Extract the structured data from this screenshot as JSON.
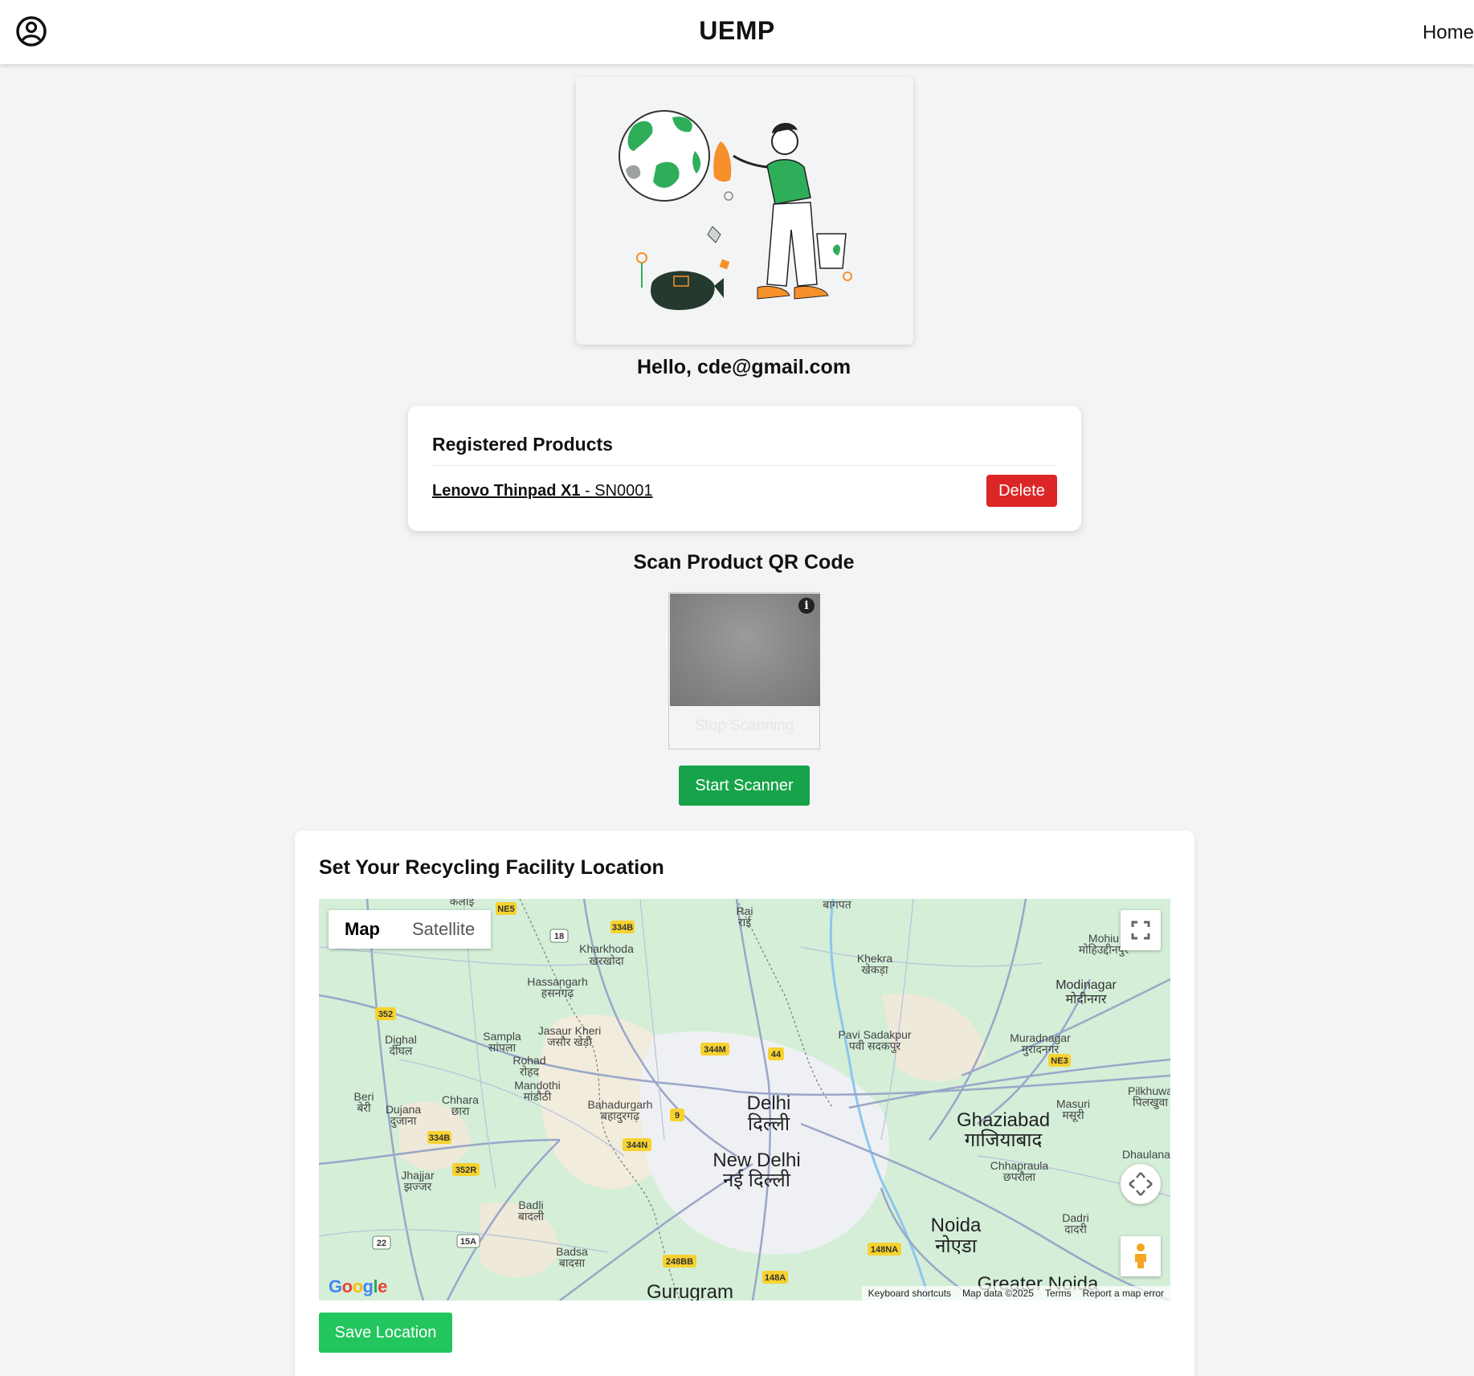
{
  "header": {
    "brand": "UEMP",
    "nav_home": "Home"
  },
  "greeting": "Hello, cde@gmail.com",
  "products": {
    "title": "Registered Products",
    "items": [
      {
        "name": "Lenovo Thinpad X1",
        "separator": " - ",
        "serial": "SN0001",
        "delete_label": "Delete"
      }
    ]
  },
  "scanner": {
    "title": "Scan Product QR Code",
    "stop_label": "Stop Scanning",
    "start_label": "Start Scanner"
  },
  "location": {
    "title": "Set Your Recycling Facility Location",
    "save_label": "Save Location",
    "map": {
      "type_map": "Map",
      "type_satellite": "Satellite",
      "active_type": "Map",
      "google": "Google",
      "footer": {
        "shortcuts": "Keyboard shortcuts",
        "data": "Map data ©2025",
        "terms": "Terms",
        "report": "Report a map error"
      },
      "places": {
        "delhi": "Delhi",
        "delhi_hi": "दिल्ली",
        "new_delhi": "New Delhi",
        "new_delhi_hi": "नई दिल्ली",
        "ghaziabad": "Ghaziabad",
        "ghaziabad_hi": "गाजियाबाद",
        "noida": "Noida",
        "noida_hi": "नोएडा",
        "greater_noida": "Greater Noida",
        "gurugram": "Gurugram",
        "modinagar": "Modinagar",
        "modinagar_hi": "मोदीनगर",
        "kharkhoda": "Kharkhoda",
        "kharkhoda_hi": "खरखोदा",
        "hassangarh": "Hassangarh",
        "hassangarh_hi": "हसनगढ़",
        "khekra": "Khekra",
        "khekra_hi": "खेकड़ा",
        "pavi": "Pavi Sadakpur",
        "pavi_hi": "पवी सदकपुर",
        "muradnagar": "Muradnagar",
        "muradnagar_hi": "मुरादनगर",
        "sampla": "Sampla",
        "sampla_hi": "सांपला",
        "jasaur": "Jasaur Kheri",
        "jasaur_hi": "जसौर खेड़ी",
        "rohad": "Rohad",
        "rohad_hi": "रोहद",
        "dighal": "Dighal",
        "dighal_hi": "दीघल",
        "mandothi": "Mandothi",
        "mandothi_hi": "मांडौठी",
        "chhara": "Chhara",
        "chhara_hi": "छारा",
        "bahadurgarh": "Bahadurgarh",
        "bahadurgarh_hi": "बहादुरगढ़",
        "beri": "Beri",
        "beri_hi": "बेरी",
        "dujana": "Dujana",
        "dujana_hi": "दुजाना",
        "jhajjar": "Jhajjar",
        "jhajjar_hi": "झज्जर",
        "badli": "Badli",
        "badli_hi": "बादली",
        "badsa": "Badsa",
        "badsa_hi": "बादसा",
        "masuri": "Masuri",
        "masuri_hi": "मसूरी",
        "pilkhuwa": "Pilkhuwa",
        "pilkhuwa_hi": "पिलखुवा",
        "chhapraula": "Chhapraula",
        "chhapraula_hi": "छपरौला",
        "dhaulana": "Dhaulana",
        "dadri": "Dadri",
        "dadri_hi": "दादरी",
        "rai": "Rai",
        "rai_hi": "राई",
        "mohiuddinpur": "Mohiu",
        "mohiuddinpur_hi": "मोहिउद्दीनपुर",
        "kalai_hi": "कलाइ",
        "baghpat_hi": "बागपत"
      },
      "highways": [
        "NE5",
        "334B",
        "18",
        "352",
        "344M",
        "44",
        "NE3",
        "9",
        "344N",
        "352R",
        "22",
        "15A",
        "248BB",
        "148A",
        "148NA",
        "334B"
      ]
    }
  },
  "colors": {
    "primary_green": "#16a34a",
    "save_green": "#22c55e",
    "delete_red": "#dc2626",
    "background": "#f3f4f6"
  }
}
